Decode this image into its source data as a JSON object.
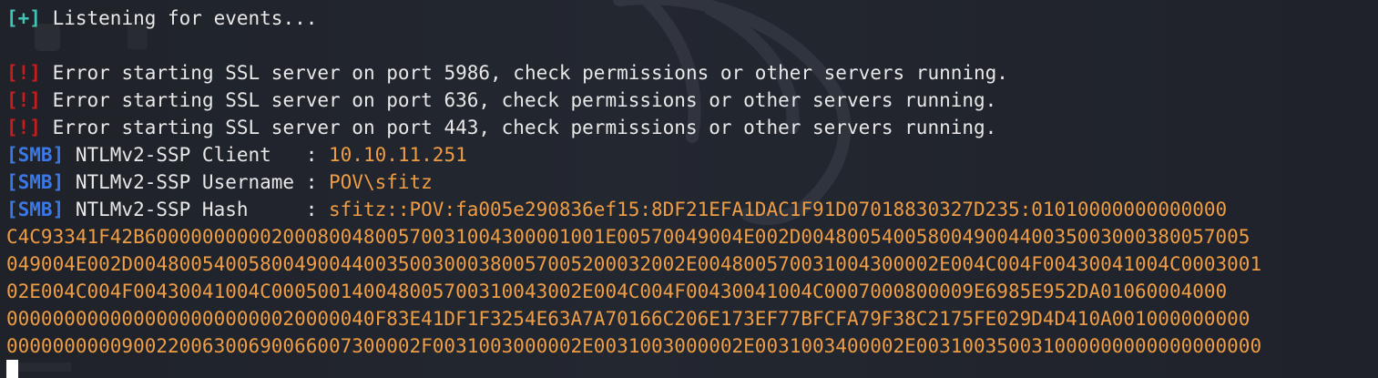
{
  "terminal": {
    "lines": [
      {
        "tag": "[+]",
        "text": " Listening for events..."
      },
      {
        "tag": "[!]",
        "text": " Error starting SSL server on port 5986, check permissions or other servers running."
      },
      {
        "tag": "[!]",
        "text": " Error starting SSL server on port 636, check permissions or other servers running."
      },
      {
        "tag": "[!]",
        "text": " Error starting SSL server on port 443, check permissions or other servers running."
      },
      {
        "tag": "[SMB]",
        "label": " NTLMv2-SSP Client   : ",
        "value": "10.10.11.251"
      },
      {
        "tag": "[SMB]",
        "label": " NTLMv2-SSP Username : ",
        "value": "POV\\sfitz"
      },
      {
        "tag": "[SMB]",
        "label": " NTLMv2-SSP Hash     : ",
        "value": "sfitz::POV:fa005e290836ef15:8DF21EFA1DAC1F91D07018830327D235:01010000000000000"
      }
    ],
    "hash_continuation": [
      "C4C93341F42B6000000000020008004800570031004300001001E00570049004E002D004800540058004900440035003000380057005",
      "049004E002D004800540058004900440035003000380057005200032002E004800570031004300002E004C004F00430041004C0003001",
      "02E004C004F00430041004C000500140048005700310043002E004C004F00430041004C0007000800009E6985E952DA01060004000",
      "00000000000000000000000020000040F83E41DF1F3254E63A7A70166C206E173EF77BFCFA79F38C2175FE029D4D410A001000000000",
      "000000000090022006300690066007300002F0031003000002E0031003000002E0031003400002E003100350031000000000000000000"
    ],
    "colors": {
      "background": "#20232a",
      "info_tag": "#41c3b6",
      "error_tag": "#c91c1c",
      "smb_tag": "#3b78e7",
      "value": "#ef9d45",
      "text": "#e8e8e8"
    }
  }
}
